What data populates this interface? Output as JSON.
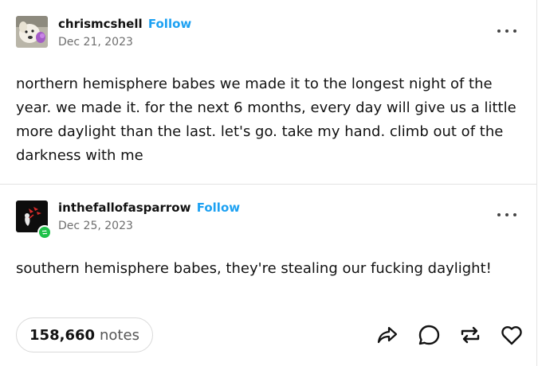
{
  "posts": [
    {
      "username": "chrismcshell",
      "follow_label": "Follow",
      "date": "Dec 21, 2023",
      "avatar_icon": "dog-avatar",
      "text": "northern hemisphere babes we made it to the longest night of the year. we made it. for the next 6 months, every day will give us a little more daylight than the last. let's go. take my hand. climb out of the darkness with me"
    },
    {
      "username": "inthefallofasparrow",
      "follow_label": "Follow",
      "date": "Dec 25, 2023",
      "avatar_icon": "sparrow-avatar",
      "text": "southern hemisphere babes, they're stealing our fucking daylight!"
    }
  ],
  "footer": {
    "notes_count": "158,660",
    "notes_label": "notes",
    "actions": [
      "share-icon",
      "reply-icon",
      "reblog-icon",
      "like-icon"
    ]
  },
  "colors": {
    "follow": "#1da1f2",
    "reblog_badge": "#1fc14a",
    "text": "#121212",
    "muted": "#6e6e6e"
  }
}
